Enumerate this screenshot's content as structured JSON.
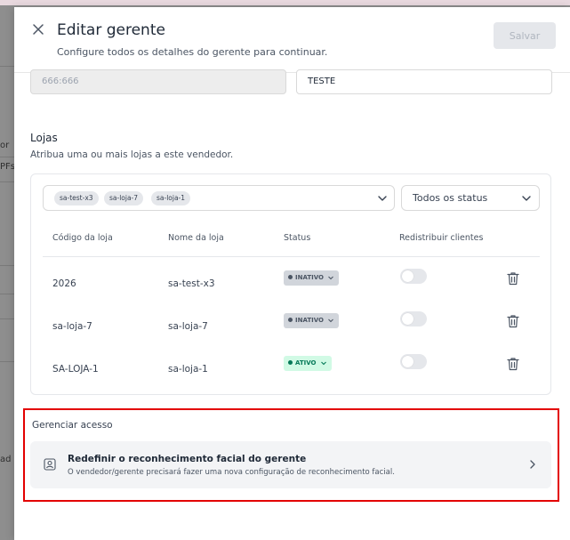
{
  "background": {
    "fragments": [
      "or",
      "PFs",
      "ad"
    ]
  },
  "header": {
    "title": "Editar gerente",
    "subtitle": "Configure todos os detalhes do gerente para continuar.",
    "save_label": "Salvar"
  },
  "fields": {
    "disabled_value": "666:666",
    "name_value": "TESTE"
  },
  "stores": {
    "title": "Lojas",
    "description": "Atribua uma ou mais lojas a este vendedor.",
    "selected_tags": [
      "sa-test-x3",
      "sa-loja-7",
      "sa-loja-1"
    ],
    "status_filter": "Todos os status",
    "columns": [
      "Código da loja",
      "Nome da loja",
      "Status",
      "Redistribuir clientes"
    ],
    "rows": [
      {
        "code": "2026",
        "name": "sa-test-x3",
        "status": "INATIVO",
        "redistribute": false
      },
      {
        "code": "sa-loja-7",
        "name": "sa-loja-7",
        "status": "INATIVO",
        "redistribute": false
      },
      {
        "code": "SA-LOJA-1",
        "name": "sa-loja-1",
        "status": "ATIVO",
        "redistribute": false
      }
    ]
  },
  "access": {
    "title": "Gerenciar acesso",
    "item_title": "Redefinir o reconhecimento facial do gerente",
    "item_desc": "O vendedor/gerente precisará fazer uma nova configuração de reconhecimento facial."
  },
  "colors": {
    "highlight_border": "#e30000",
    "active_badge_bg": "#d1fae5",
    "inactive_badge_bg": "#d1d5db"
  },
  "icons": [
    "close-icon",
    "chevron-down-icon",
    "trash-icon",
    "face-id-icon",
    "chevron-right-icon"
  ]
}
